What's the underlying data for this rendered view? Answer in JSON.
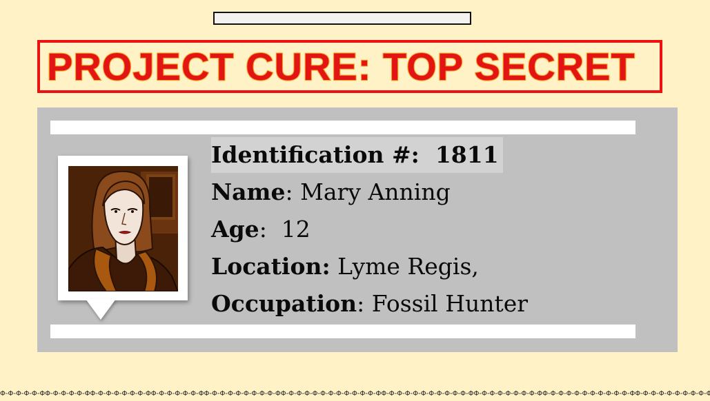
{
  "title": "PROJECT CURE: TOP SECRET",
  "profile": {
    "id_label": "Identification #:",
    "id_value": "1811",
    "name_label": "Name",
    "name_value": ": Mary Anning",
    "age_label": "Age",
    "age_value": ":  12",
    "location_label": "Location:",
    "location_value": " Lyme Regis,",
    "occupation_label": "Occupation",
    "occupation_value": ": Fossil Hunter"
  },
  "footer_pattern": "Φ-Φ-Φ-Φ-Φ-ΦΦ-Φ-Φ-Φ-Φ-ΦΦ-Φ-Φ-Φ-Φ-Φ-Φ-ΦΦ-Φ-Φ-Φ-Φ-Φ-ΦΦ-Φ-Φ-Φ-Φ-Φ-Φ-Φ-Φ-ΦΦ-Φ-Φ-Φ-Φ-Φ-Φ-Φ-Φ-Φ-Φ-Φ-ΦΦ-Φ-Φ-Φ-Φ-Φ-Φ-Φ-Φ-Φ-Φ-ΦΦ-Φ-Φ-Φ-Φ-Φ-Φ-Φ-ΦΦ-Φ-Φ-Φ-Φ-Φ-Φ-Φ-Φ-Φ-Φ-ΦΦ-Φ-Φ-Φ-Φ-Φ-Φ-Φ-Φ-Φ-Φ-",
  "colors": {
    "background": "#fff2c6",
    "title_red": "#e21414",
    "title_outline": "#f29a1c",
    "card_gray": "#c0c0c0"
  },
  "icons": {
    "portrait": "portrait-illustration"
  }
}
